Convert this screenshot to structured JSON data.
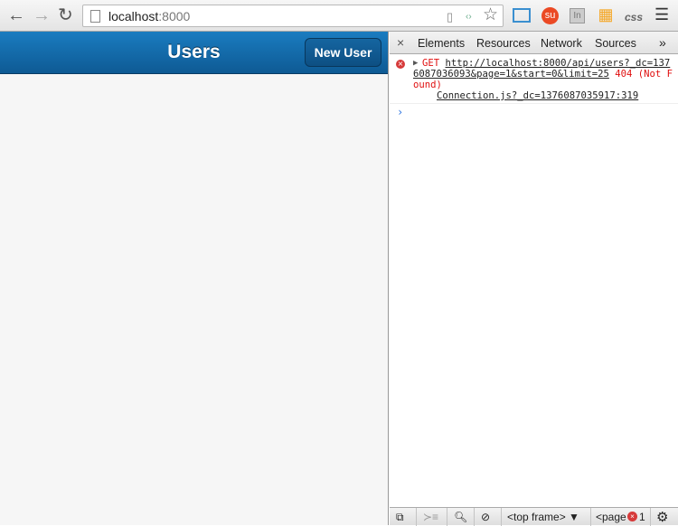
{
  "browser": {
    "url_host": "localhost",
    "url_port": ":8000",
    "icons": [
      "back-icon",
      "forward-icon",
      "reload-icon",
      "page-icon",
      "mobile-icon",
      "source-icon",
      "star-icon",
      "window-resizer-icon",
      "stumbleupon-icon",
      "linkedin-icon",
      "aws-icon",
      "css-icon",
      "menu-icon"
    ],
    "css_label": "css",
    "in_label": "In"
  },
  "app": {
    "title": "Users",
    "new_user_label": "New User",
    "accent": "#1a6fb0"
  },
  "devtools": {
    "tabs": [
      "Elements",
      "Resources",
      "Network",
      "Sources"
    ],
    "more": "»",
    "close": "×",
    "console": {
      "method": "GET",
      "url": "http://localhost:8000/api/users?_dc=1376087036093&page=1&start=0&limit=25",
      "status": "404 (Not Found)",
      "source": "Connection.js?_dc=1376087035917:319",
      "prompt": "›"
    },
    "bottom": {
      "frame": "<top frame> ▼",
      "page": "<page",
      "error_count": "1"
    }
  }
}
